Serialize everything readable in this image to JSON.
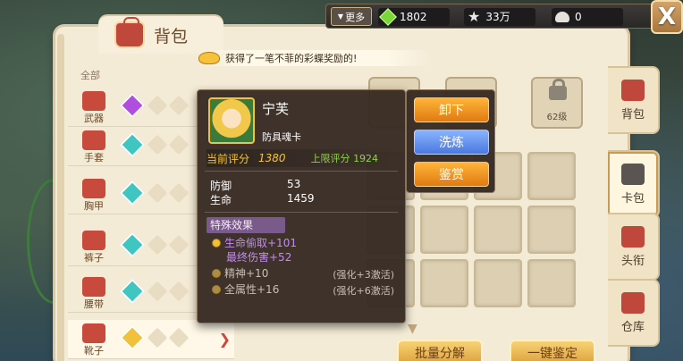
{
  "header": {
    "title": "背包",
    "more_label": "更多",
    "resources": [
      {
        "icon": "green-gem-icon",
        "value": "1802"
      },
      {
        "icon": "star-icon",
        "value": "33万"
      },
      {
        "icon": "shell-icon",
        "value": "0"
      }
    ],
    "close_label": "X"
  },
  "notice": "获得了一笔不菲的彩蝶奖励的!",
  "categories": {
    "all_label": "全部",
    "items": [
      {
        "label": "武器",
        "gem_color": "#b04ee0"
      },
      {
        "label": "手套",
        "gem_color": "#3fc6c0"
      },
      {
        "label": "胸甲",
        "gem_color": "#3fc6c0"
      },
      {
        "label": "裤子",
        "gem_color": "#3fc6c0"
      },
      {
        "label": "腰带",
        "gem_color": "#3fc6c0"
      },
      {
        "label": "靴子",
        "gem_color": "#f2c13b"
      }
    ]
  },
  "lock_slot": {
    "level": "62级"
  },
  "tooltip": {
    "name": "宁芙",
    "type": "防具魂卡",
    "current_score_label": "当前评分",
    "current_score": "1380",
    "max_score_label": "上限评分",
    "max_score": "1924",
    "stats": [
      {
        "label": "防御",
        "value": "53"
      },
      {
        "label": "生命",
        "value": "1459"
      }
    ],
    "special_header": "特殊效果",
    "effects": [
      {
        "text": "生命偷取+101",
        "note": "",
        "style": "purple"
      },
      {
        "text": "最终伤害+52",
        "note": "",
        "style": "purple"
      },
      {
        "text": "精神+10",
        "note": "(强化+3激活)",
        "style": "grey"
      },
      {
        "text": "全属性+16",
        "note": "(强化+6激活)",
        "style": "grey"
      }
    ]
  },
  "actions": {
    "unequip": "卸下",
    "refine": "洗炼",
    "appraise": "鉴赏"
  },
  "right_tabs": [
    {
      "label": "背包",
      "active": false
    },
    {
      "label": "卡包",
      "active": true
    },
    {
      "label": "头衔",
      "active": false
    },
    {
      "label": "仓库",
      "active": false
    }
  ],
  "bottom_buttons": {
    "batch_decompose": "批量分解",
    "one_click_appraise": "一键鉴定"
  }
}
